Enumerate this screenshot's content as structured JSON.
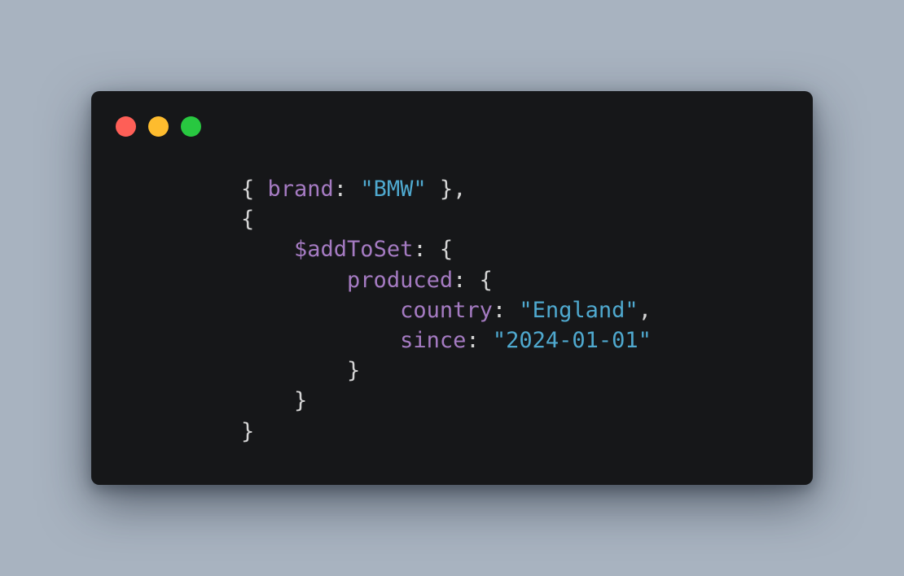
{
  "window": {
    "controls": [
      {
        "name": "close",
        "color": "#fe5f57"
      },
      {
        "name": "minimize",
        "color": "#febc2e"
      },
      {
        "name": "maximize",
        "color": "#28c840"
      }
    ]
  },
  "colors": {
    "background": "#a8b3c0",
    "window": "#161719",
    "key": "#a57bc2",
    "string": "#4fa9cf",
    "punctuation": "#d4d4d4"
  },
  "code": {
    "language": "javascript",
    "lines": [
      [
        {
          "t": "punc",
          "v": "{ "
        },
        {
          "t": "key",
          "v": "brand"
        },
        {
          "t": "punc",
          "v": ": "
        },
        {
          "t": "str",
          "v": "\"BMW\""
        },
        {
          "t": "punc",
          "v": " },"
        }
      ],
      [
        {
          "t": "punc",
          "v": "{"
        }
      ],
      [
        {
          "t": "punc",
          "v": "    "
        },
        {
          "t": "key",
          "v": "$addToSet"
        },
        {
          "t": "punc",
          "v": ": {"
        }
      ],
      [
        {
          "t": "punc",
          "v": "        "
        },
        {
          "t": "key",
          "v": "produced"
        },
        {
          "t": "punc",
          "v": ": {"
        }
      ],
      [
        {
          "t": "punc",
          "v": "            "
        },
        {
          "t": "key",
          "v": "country"
        },
        {
          "t": "punc",
          "v": ": "
        },
        {
          "t": "str",
          "v": "\"England\""
        },
        {
          "t": "punc",
          "v": ","
        }
      ],
      [
        {
          "t": "punc",
          "v": "            "
        },
        {
          "t": "key",
          "v": "since"
        },
        {
          "t": "punc",
          "v": ": "
        },
        {
          "t": "str",
          "v": "\"2024-01-01\""
        }
      ],
      [
        {
          "t": "punc",
          "v": "        }"
        }
      ],
      [
        {
          "t": "punc",
          "v": "    }"
        }
      ],
      [
        {
          "t": "punc",
          "v": "}"
        }
      ]
    ]
  }
}
